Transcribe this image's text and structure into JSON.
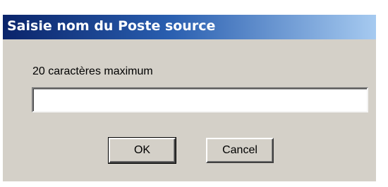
{
  "window": {
    "title": "Saisie nom du Poste source"
  },
  "form": {
    "label": "20 caractères maximum",
    "input_value": ""
  },
  "buttons": {
    "ok_label": "OK",
    "cancel_label": "Cancel"
  },
  "colors": {
    "dialog_bg": "#d4d0c8",
    "title_start": "#0a246a",
    "title_end": "#a6caf0",
    "title_text": "#ffffff"
  }
}
